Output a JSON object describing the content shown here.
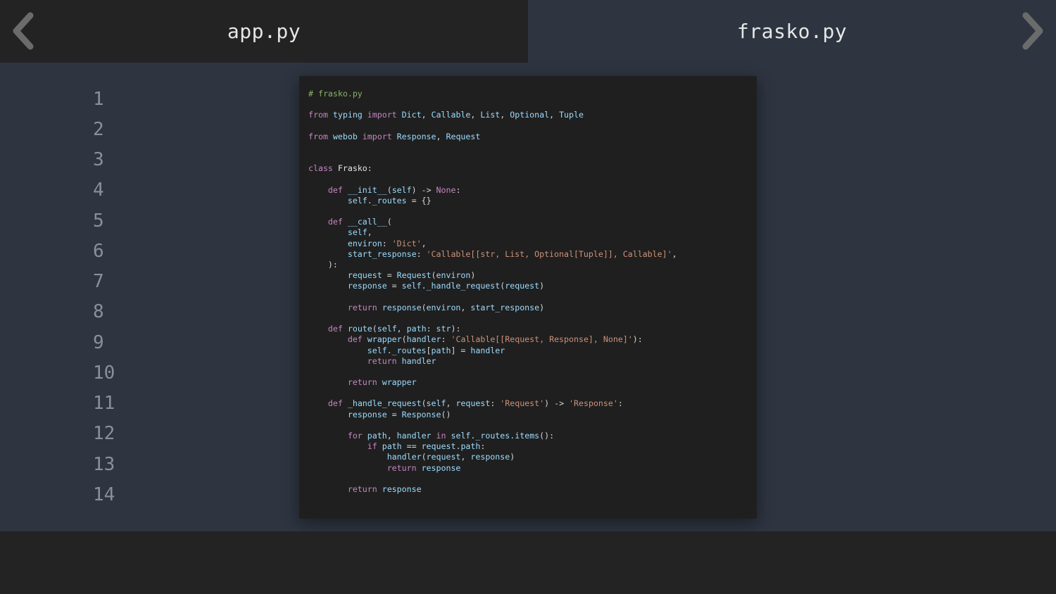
{
  "tabs": [
    {
      "label": "app.py",
      "active": false
    },
    {
      "label": "frasko.py",
      "active": true
    }
  ],
  "navigation": {
    "prev_icon": "chevron-left-icon",
    "next_icon": "chevron-right-icon"
  },
  "gutter": {
    "line_numbers": [
      "1",
      "2",
      "3",
      "4",
      "5",
      "6",
      "7",
      "8",
      "9",
      "10",
      "11",
      "12",
      "13",
      "14"
    ]
  },
  "colors": {
    "background": "#2e3541",
    "dark_bar": "#232323",
    "code_card": "#1f1f1f",
    "comment": "#8ab26a",
    "keyword": "#c586c0",
    "string": "#ce9178",
    "identifier": "#9cdcfe"
  },
  "code": {
    "filename_comment": "# frasko.py",
    "lines": [
      "# frasko.py",
      "",
      "from typing import Dict, Callable, List, Optional, Tuple",
      "",
      "from webob import Response, Request",
      "",
      "",
      "class Frasko:",
      "",
      "    def __init__(self) -> None:",
      "        self._routes = {}",
      "",
      "    def __call__(",
      "        self,",
      "        environ: 'Dict',",
      "        start_response: 'Callable[[str, List, Optional[Tuple]], Callable]',",
      "    ):",
      "        request = Request(environ)",
      "        response = self._handle_request(request)",
      "",
      "        return response(environ, start_response)",
      "",
      "    def route(self, path: str):",
      "        def wrapper(handler: 'Callable[[Request, Response], None]'):",
      "            self._routes[path] = handler",
      "            return handler",
      "",
      "        return wrapper",
      "",
      "    def _handle_request(self, request: 'Request') -> 'Response':",
      "        response = Response()",
      "",
      "        for path, handler in self._routes.items():",
      "            if path == request.path:",
      "                handler(request, response)",
      "                return response",
      "",
      "        return response"
    ]
  }
}
